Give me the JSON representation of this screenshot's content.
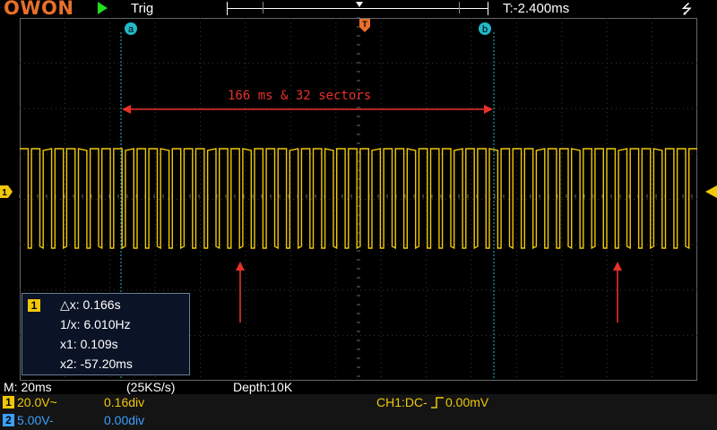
{
  "header": {
    "logo": "OWON",
    "trigger_state": "Trig",
    "time_position": "T:-2.400ms",
    "usb_symbol": "⭍"
  },
  "cursors": {
    "a_label": "a",
    "b_label": "b",
    "trigger_label": "T"
  },
  "annotation": {
    "text": "166 ms & 32 sectors"
  },
  "measure": {
    "channel": "1",
    "dx": "△x: 0.166s",
    "inv_dx": "1/x: 6.010Hz",
    "x1": "x1: 0.109s",
    "x2": "x2: -57.20ms"
  },
  "status": {
    "timebase": "M: 20ms",
    "sample_rate": "(25KS/s)",
    "depth": "Depth:10K"
  },
  "channels": [
    {
      "badge": "1",
      "scale": "20.0V~",
      "offset": "0.16div",
      "color": "#f0c808"
    },
    {
      "badge": "2",
      "scale": "5.00V-",
      "offset": "0.00div",
      "color": "#3aa0ff"
    }
  ],
  "trigger": {
    "info": "CH1:DC-",
    "level": "0.00mV"
  },
  "colors": {
    "ch1": "#f0c808",
    "ch2": "#3aa0ff",
    "cursor": "#22b8c8",
    "annotation": "#e8312a",
    "logo": "#e8702a"
  }
}
